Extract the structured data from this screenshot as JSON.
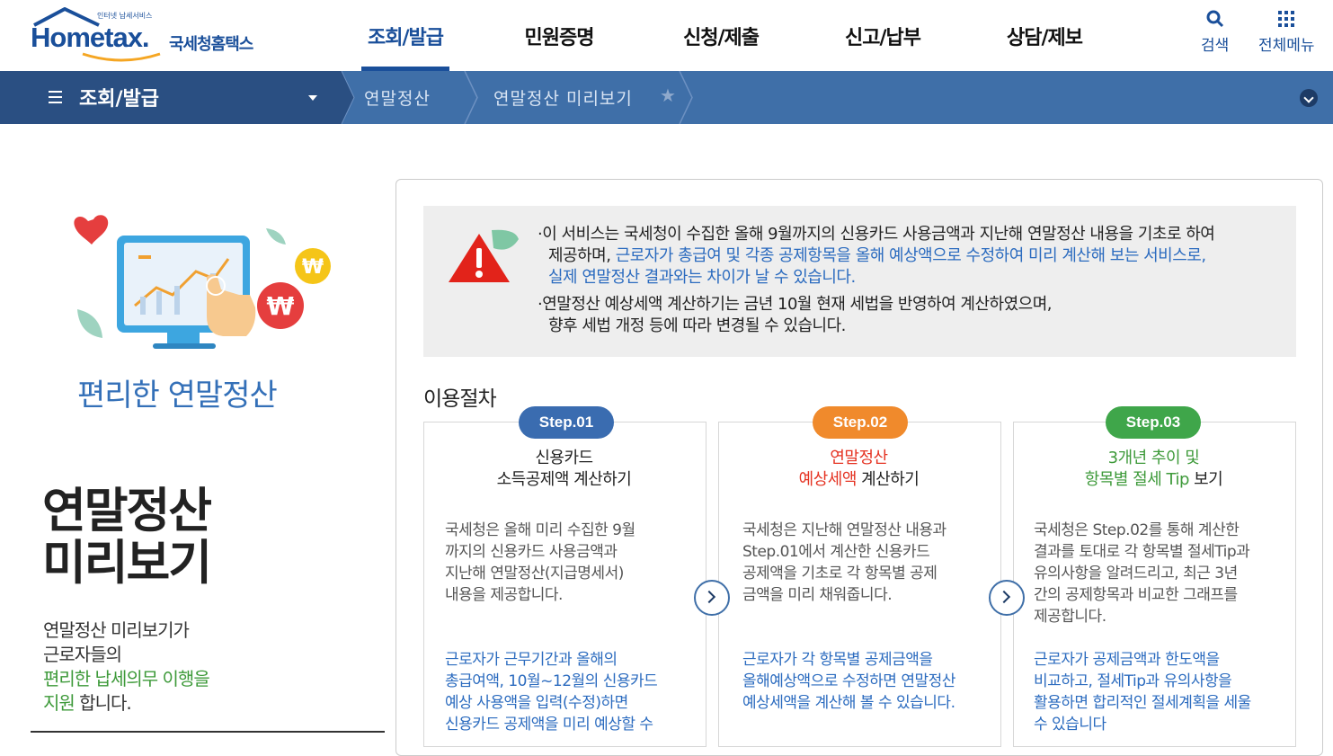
{
  "header": {
    "logo_tag": "인터넷 납세서비스",
    "logo_main": "Hometax.",
    "logo_sub": "국세청홈택스",
    "nav": [
      "조회/발급",
      "민원증명",
      "신청/제출",
      "신고/납부",
      "상담/제보"
    ],
    "search_label": "검색",
    "allmenu_label": "전체메뉴"
  },
  "subnav": {
    "menu_label": "조회/발급",
    "crumb1": "연말정산",
    "crumb2": "연말정산 미리보기"
  },
  "left": {
    "small_title": "편리한 연말정산",
    "big_title_line1": "연말정산",
    "big_title_line2": "미리보기",
    "desc_line1": "연말정산 미리보기가",
    "desc_line2": "근로자들의",
    "desc_line3": "편리한 납세의무 이행을",
    "desc_line4_green": "지원",
    "desc_line4_rest": " 합니다."
  },
  "notice": {
    "l1": "·이 서비스는 국세청이 수집한 올해 9월까지의 신용카드 사용금액과 지난해 연말정산 내용을 기초로 하여",
    "l2a": "제공하며, ",
    "l2b": "근로자가 총급여 및 각종 공제항목을 올해 예상액으로 수정하여 미리 계산해 보는 서비스로,",
    "l3": "실제 연말정산 결과와는 차이가 날 수 있습니다.",
    "l4": "·연말정산 예상세액 계산하기는 금년 10월 현재 세법을 반영하여 계산하였으며,",
    "l5": "향후 세법 개정 등에 따라 변경될 수 있습니다."
  },
  "procedure_title": "이용절차",
  "steps": [
    {
      "badge": "Step.01",
      "title1": "신용카드",
      "title2": "소득공제액 계산하기",
      "text": [
        "국세청은 올해 미리 수집한 9월",
        "까지의 신용카드 사용금액과",
        "지난해 연말정산(지급명세서)",
        "내용을 제공합니다."
      ],
      "text2": [
        "근로자가 근무기간과 올해의",
        "총급여액, 10월~12월의 신용카드",
        "예상 사용액을 입력(수정)하면",
        "신용카드 공제액을 미리 예상할 수"
      ]
    },
    {
      "badge": "Step.02",
      "title1": "연말정산",
      "title2a": "예상세액",
      "title2b": " 계산하기",
      "text": [
        "국세청은 지난해 연말정산 내용과",
        "Step.01에서 계산한 신용카드",
        "공제액을 기초로 각 항목별 공제",
        "금액을 미리 채워줍니다."
      ],
      "text2": [
        "근로자가 각 항목별 공제금액을",
        "올해예상액으로 수정하면 연말정산",
        "예상세액을 계산해 볼 수 있습니다."
      ]
    },
    {
      "badge": "Step.03",
      "title1": "3개년 추이 및",
      "title2a": "항목별 절세 Tip",
      "title2b": " 보기",
      "text": [
        "국세청은 Step.02를 통해 계산한",
        "결과를 토대로 각 항목별 절세Tip과",
        "유의사항을 알려드리고, 최근 3년",
        "간의 공제항목과 비교한 그래프를",
        "제공합니다."
      ],
      "text2": [
        "근로자가 공제금액과 한도액을",
        "비교하고, 절세Tip과 유의사항을",
        "활용하면 합리적인 절세계획을 세울",
        "수 있습니다"
      ]
    }
  ],
  "colors": {
    "brand": "#1a4f9a",
    "subnav": "#3f6fa8",
    "step1": "#3a6cb0",
    "step2": "#f08a2c",
    "step3": "#3fa64a"
  }
}
